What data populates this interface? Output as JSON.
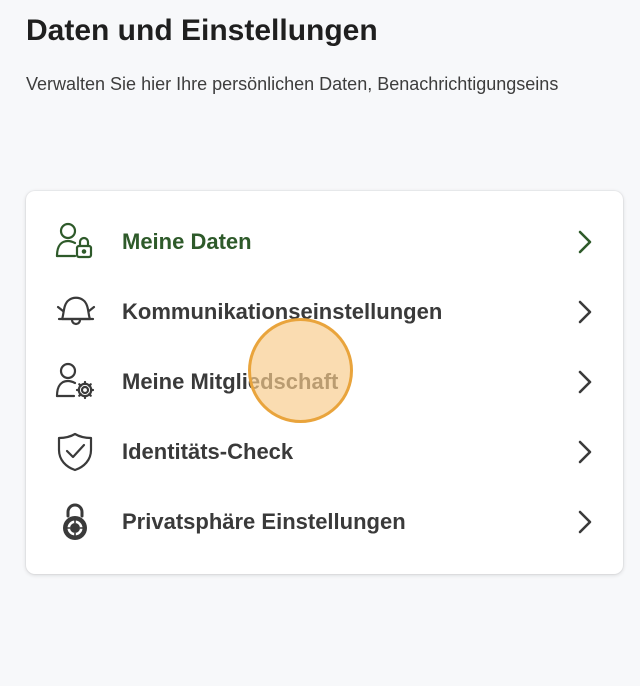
{
  "header": {
    "title": "Daten und Einstellungen",
    "subtitle": "Verwalten Sie hier Ihre persönlichen Daten, Benachrichtigungseins"
  },
  "menu": {
    "items": [
      {
        "label": "Meine Daten",
        "icon": "user-lock-icon",
        "active": true
      },
      {
        "label": "Kommunikationseinstellungen",
        "icon": "bell-icon",
        "active": false
      },
      {
        "label": "Meine Mitgliedschaft",
        "icon": "user-gear-icon",
        "active": false
      },
      {
        "label": "Identitäts-Check",
        "icon": "shield-check-icon",
        "active": false
      },
      {
        "label": "Privatsphäre Einstellungen",
        "icon": "combination-lock-icon",
        "active": false
      }
    ]
  },
  "colors": {
    "active": "#2e5a2a",
    "text": "#3a3a3a",
    "touch_indicator": "#f7cc8c"
  }
}
